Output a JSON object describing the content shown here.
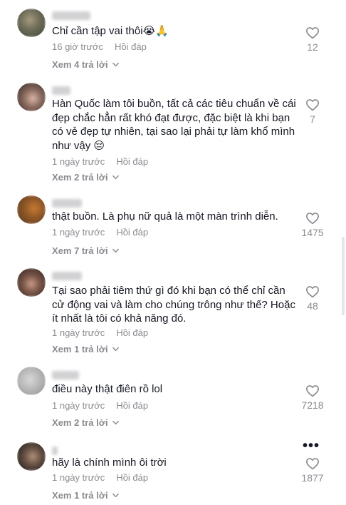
{
  "comments": [
    {
      "text": "Chỉ cần tập vai thôi😭🙏",
      "time": "16 giờ trước",
      "reply_label": "Hồi đáp",
      "likes": "12",
      "view_replies": "Xem 4 trả lời",
      "avatar_colors": [
        "#3d4b3a",
        "#a89a80"
      ]
    },
    {
      "text": "Hàn Quốc làm tôi buồn, tất cả các tiêu chuẩn về cái đẹp chắc hẳn rất khó đạt được, đặc biệt là khi bạn có vẻ đẹp tự nhiên, tại sao lại phải tự làm khổ mình như vậy 😔",
      "time": "1 ngày trước",
      "reply_label": "Hồi đáp",
      "likes": "7",
      "view_replies": "Xem 2 trả lời",
      "avatar_colors": [
        "#2b2320",
        "#d9b8a8"
      ]
    },
    {
      "text": "thật buồn. Là phụ nữ quả là một màn trình diễn.",
      "time": "1 ngày trước",
      "reply_label": "Hồi đáp",
      "likes": "1475",
      "view_replies": "Xem 7 trả lời",
      "avatar_colors": [
        "#5a3a1e",
        "#c87a30"
      ]
    },
    {
      "text": "Tại sao phải tiêm thứ gì đó khi bạn có thể chỉ cần cử động vai và làm cho chúng trông như thế? Hoặc ít nhất là tôi có khả năng đó.",
      "time": "1 ngày trước",
      "reply_label": "Hồi đáp",
      "likes": "48",
      "view_replies": "Xem 1 trả lời",
      "avatar_colors": [
        "#2a1e1a",
        "#c99a86"
      ]
    },
    {
      "text": "điều này thật điên rồ lol",
      "time": "1 ngày trước",
      "reply_label": "Hồi đáp",
      "likes": "7218",
      "view_replies": "Xem 2 trả lời",
      "avatar_colors": [
        "#d8d8d8",
        "#8f8f8f"
      ]
    },
    {
      "text": "hãy là chính mình ôi trời",
      "time": "1 ngày trước",
      "reply_label": "Hồi đáp",
      "likes": "1877",
      "view_replies": "Xem 1 trả lời",
      "avatar_colors": [
        "#1c1c1c",
        "#b08f78"
      ]
    }
  ],
  "more_options": "•••",
  "icons": {
    "like": "heart-outline-icon",
    "expand": "chevron-down-icon",
    "more": "more-horizontal-icon"
  }
}
